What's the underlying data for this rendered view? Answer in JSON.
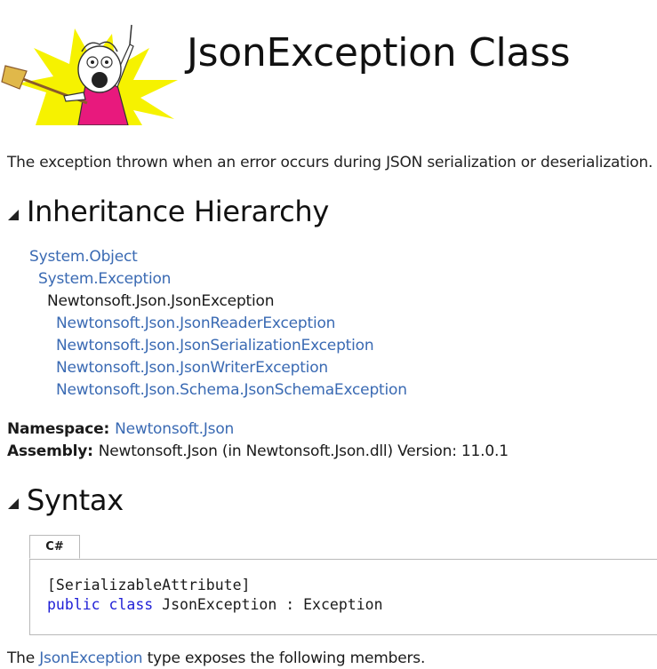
{
  "header": {
    "title": "JsonException Class",
    "logo_icon": "x-all-the-y-meme-logo"
  },
  "summary": "The exception thrown when an error occurs during JSON serialization or deserialization.",
  "inheritance": {
    "heading": "Inheritance Hierarchy",
    "items": [
      {
        "label": "System.Object",
        "level": 0,
        "is_link": true
      },
      {
        "label": "System.Exception",
        "level": 1,
        "is_link": true
      },
      {
        "label": "Newtonsoft.Json.JsonException",
        "level": 2,
        "is_link": false
      },
      {
        "label": "Newtonsoft.Json.JsonReaderException",
        "level": 3,
        "is_link": true
      },
      {
        "label": "Newtonsoft.Json.JsonSerializationException",
        "level": 3,
        "is_link": true
      },
      {
        "label": "Newtonsoft.Json.JsonWriterException",
        "level": 3,
        "is_link": true
      },
      {
        "label": "Newtonsoft.Json.Schema.JsonSchemaException",
        "level": 3,
        "is_link": true
      }
    ]
  },
  "namespace": {
    "label": "Namespace:",
    "value": "Newtonsoft.Json"
  },
  "assembly": {
    "label": "Assembly:",
    "value": "Newtonsoft.Json (in Newtonsoft.Json.dll) Version: 11.0.1"
  },
  "syntax": {
    "heading": "Syntax",
    "tab_label": "C#",
    "line1": "[SerializableAttribute]",
    "line2_kw1": "public",
    "line2_kw2": "class",
    "line2_rest": "JsonException : Exception"
  },
  "footer": {
    "prefix": "The ",
    "link": "JsonException",
    "suffix": " type exposes the following members."
  },
  "colors": {
    "link": "#3a6ab3",
    "keyword": "#1f1fd6",
    "logo_yellow": "#f6f200",
    "logo_pink": "#e8197d"
  }
}
